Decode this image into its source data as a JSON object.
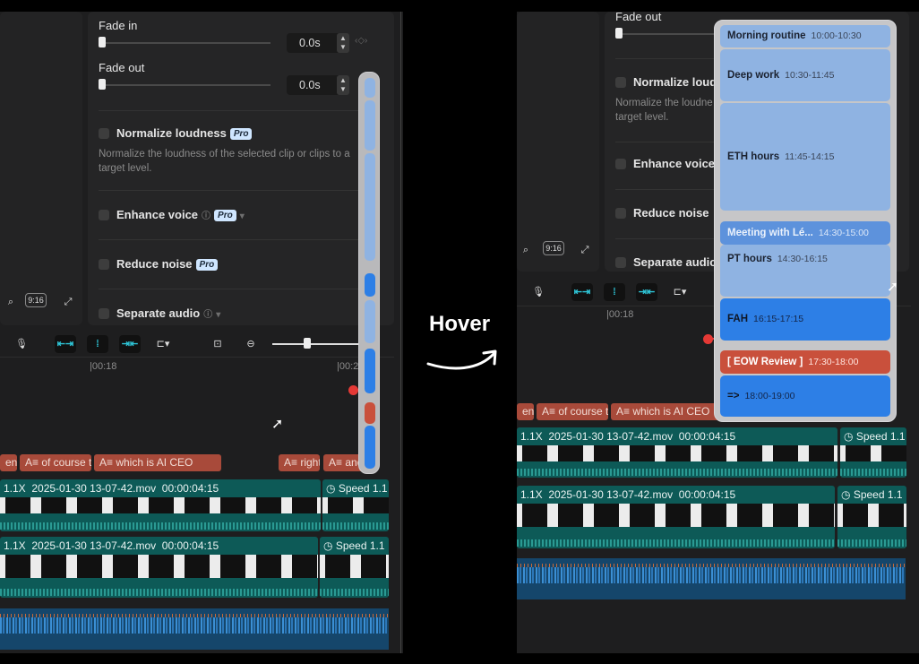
{
  "left_view": {
    "fade_in": {
      "label": "Fade in",
      "value": "0.0s"
    },
    "fade_out": {
      "label": "Fade out",
      "value": "0.0s"
    },
    "normalize": {
      "label": "Normalize loudness",
      "badge": "Pro",
      "description": "Normalize the loudness of the selected clip or clips to a target level."
    },
    "enhance_voice": {
      "label": "Enhance voice",
      "badge": "Pro"
    },
    "reduce_noise": {
      "label": "Reduce noise",
      "badge": "Pro"
    },
    "separate_audio": {
      "label": "Separate audio"
    },
    "ratio_button": "9:16",
    "ruler": {
      "mark1": "|00:18",
      "mark2": "|00:2"
    },
    "text_clips": [
      "en y",
      "A≡ of course th",
      "A≡ which is AI CEO",
      "A≡ right",
      "A≡ and"
    ],
    "video_track_1": {
      "speed": "1.1X",
      "filename": "2025-01-30 13-07-42.mov",
      "duration": "00:00:04:15",
      "speed_badge": "Speed 1.1"
    },
    "video_track_2": {
      "speed": "1.1X",
      "filename": "2025-01-30 13-07-42.mov",
      "duration": "00:00:04:15",
      "speed_badge": "Speed 1.1"
    }
  },
  "hover_label": "Hover",
  "right_view": {
    "fade_out_label": "Fade out",
    "normalize": {
      "label": "Normalize loudn",
      "description": "Normalize the loudne target level."
    },
    "enhance_voice": {
      "label": "Enhance voice"
    },
    "reduce_noise": {
      "label": "Reduce noise"
    },
    "separate_audio": {
      "label": "Separate audio"
    },
    "ratio_button": "9:16",
    "ruler": {
      "mark1": "|00:18"
    },
    "text_clips": [
      "en y",
      "A≡ of course th",
      "A≡ which is AI CEO"
    ],
    "video_track_1": {
      "speed": "1.1X",
      "filename": "2025-01-30 13-07-42.mov",
      "duration": "00:00:04:15",
      "speed_badge": "Speed 1.1"
    },
    "video_track_2": {
      "speed": "1.1X",
      "filename": "2025-01-30 13-07-42.mov",
      "duration": "00:00:04:15",
      "speed_badge": "Speed 1.1"
    }
  },
  "calendar": {
    "events": [
      {
        "title": "Morning routine",
        "time": "10:00-10:30",
        "style": "pale"
      },
      {
        "title": "Deep work",
        "time": "10:30-11:45",
        "style": "pale"
      },
      {
        "title": "ETH hours",
        "time": "11:45-14:15",
        "style": "pale"
      },
      {
        "title": "Meeting with Lé...",
        "time": "14:30-15:00",
        "style": "pale"
      },
      {
        "title": "PT hours",
        "time": "14:30-16:15",
        "style": "pale"
      },
      {
        "title": "FAH",
        "time": "16:15-17:15",
        "style": "bright"
      },
      {
        "title": "[ EOW Review ]",
        "time": "17:30-18:00",
        "style": "red"
      },
      {
        "title": "=>",
        "time": "18:00-19:00",
        "style": "bright"
      }
    ]
  },
  "colors": {
    "accent_cyan": "#2ec4d6",
    "event_pale": "#8fb3e2",
    "event_bright": "#2d7fe6",
    "event_red": "#c9503c",
    "playhead": "#e53935",
    "video_clip": "#0d5a57",
    "audio_clip": "#15466b"
  }
}
